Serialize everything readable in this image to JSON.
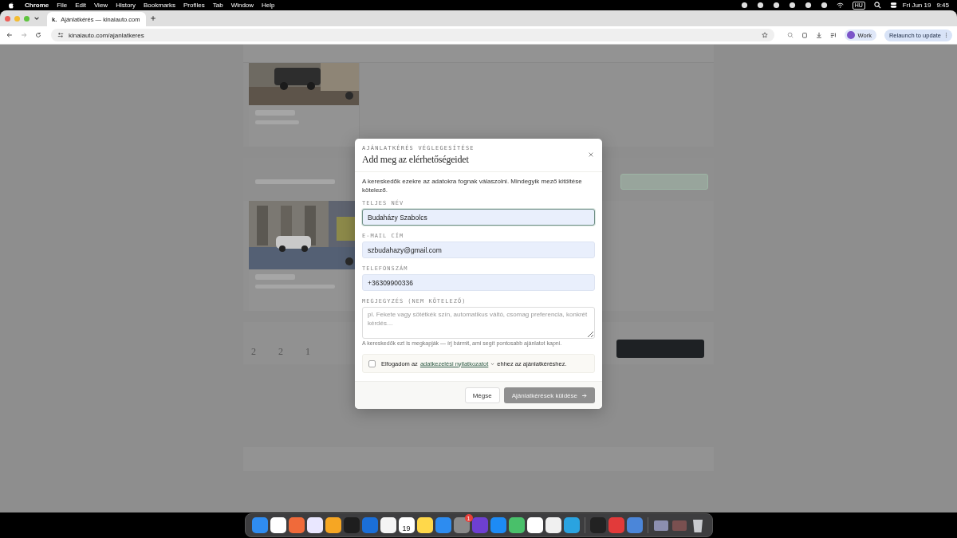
{
  "menubar": {
    "app": "Chrome",
    "menus": [
      "File",
      "Edit",
      "View",
      "History",
      "Bookmarks",
      "Profiles",
      "Tab",
      "Window",
      "Help"
    ],
    "input_source": "HU",
    "date": "Fri Jun 19",
    "time": "9:45"
  },
  "browser": {
    "tab_favicon": "k.",
    "tab_title": "Ajánlatkérés — kinaiauto.com",
    "url": "kinaiauto.com/ajanlatkeres",
    "profile": "Work",
    "relaunch": "Relaunch to update"
  },
  "page": {
    "stats": [
      "2",
      "2",
      "1"
    ]
  },
  "modal": {
    "eyebrow": "AJÁNLATKÉRÉS VÉGLEGESÍTÉSE",
    "title": "Add meg az elérhetőségeidet",
    "intro": "A kereskedők ezekre az adatokra fognak válaszolni. Mindegyik mező kitöltése kötelező.",
    "fields": [
      {
        "kind": "input",
        "label": "TELJES NÉV",
        "value": "Budaházy Szabolcs",
        "focused": true
      },
      {
        "kind": "input",
        "label": "E-MAIL CÍM",
        "value": "szbudahazy@gmail.com",
        "focused": false
      },
      {
        "kind": "input",
        "label": "TELEFONSZÁM",
        "value": "+36309900336",
        "focused": false
      },
      {
        "kind": "textarea",
        "label": "MEGJEGYZÉS (NEM KÖTELEZŐ)",
        "placeholder": "pl. Fekete vagy sötétkék szín, automatikus váltó, csomag preferencia, konkrét kérdés…",
        "focused": false
      }
    ],
    "hint": "A kereskedők ezt is megkapják — írj bármit, ami segít pontosabb ajánlatot kapni.",
    "consent": {
      "checked": false,
      "before": "Elfogadom az",
      "link": "adatkezelési nyilatkozatot",
      "after": "ehhez az ajánlatkéréshez."
    },
    "cancel": "Mégse",
    "submit": {
      "label": "Ajánlatkérések küldése",
      "disabled": true
    }
  },
  "dock": {
    "calendar_day": "19",
    "settings_badge": "1"
  }
}
